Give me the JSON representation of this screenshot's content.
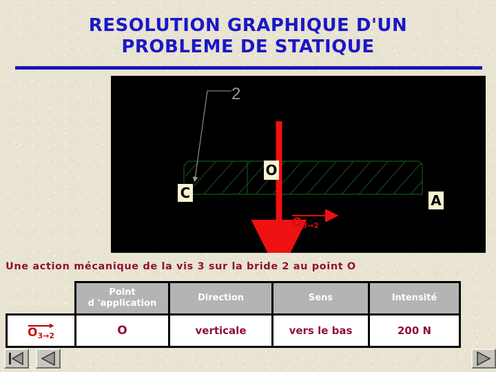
{
  "slide": {
    "title_line1": "RESOLUTION GRAPHIQUE D'UN",
    "title_line2": "PROBLEME DE STATIQUE",
    "caption": "Une action mécanique de la vis 3 sur la bride 2 au point O",
    "accent_blue": "#1a18c8",
    "accent_maroon": "#8f1038",
    "background": "#e9e3d2"
  },
  "figure": {
    "background": "#000000",
    "part_label": "2",
    "point_labels": {
      "left": "C",
      "center": "O",
      "right": "A"
    },
    "force_vector": {
      "base": "O",
      "subscript": "3→2",
      "color": "#ee1111",
      "direction": "down"
    },
    "hatching_color": "#0d4a16",
    "leader_color": "#9a9a9a",
    "label_box_color": "#faf3d2"
  },
  "table": {
    "headers": [
      "",
      "Point\nd 'application",
      "Direction",
      "Sens",
      "Intensité"
    ],
    "header_point_line1": "Point",
    "header_point_line2": "d 'application",
    "header_direction": "Direction",
    "header_sens": "Sens",
    "header_intensite": "Intensité",
    "row": {
      "vector_base": "O",
      "vector_subscript": "3→2",
      "point": "O",
      "direction": "verticale",
      "sens": "vers le bas",
      "intensite": "200 N"
    },
    "header_bg": "#b4b4b4",
    "header_text": "#ffffff",
    "cell_bg": "#ffffff",
    "cell_text": "#8f1038"
  },
  "nav": {
    "first_label": "first-slide",
    "prev_label": "previous-slide",
    "next_label": "next-slide"
  }
}
